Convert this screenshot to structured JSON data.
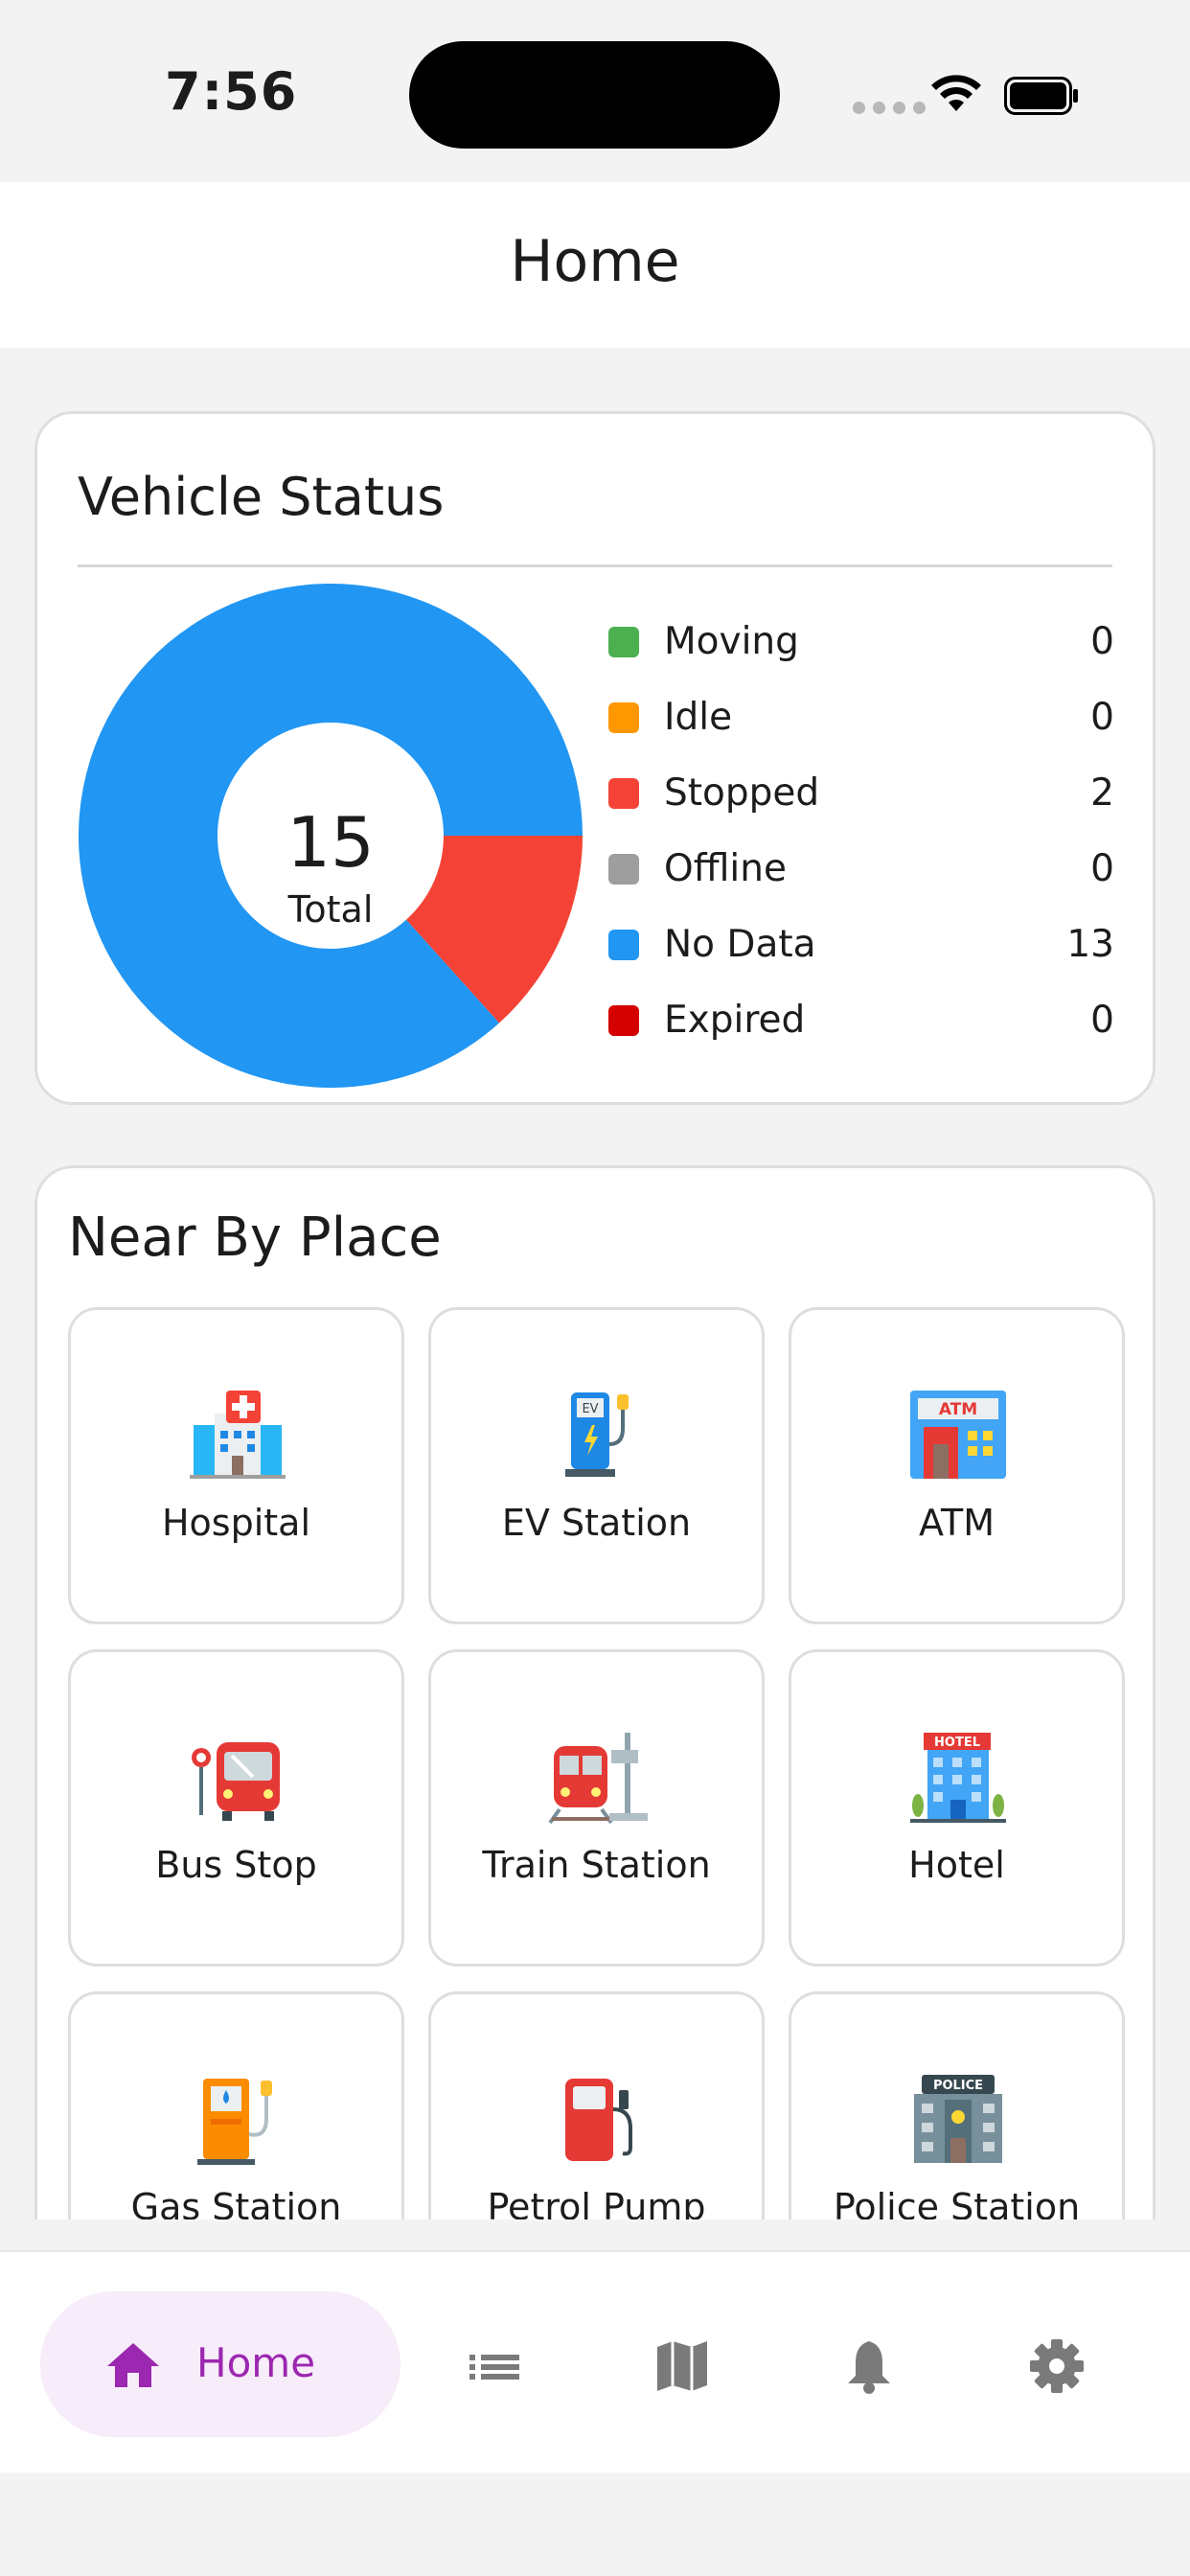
{
  "status_bar": {
    "time": "7:56"
  },
  "header": {
    "title": "Home"
  },
  "vehicle_status": {
    "title": "Vehicle Status",
    "total": "15",
    "total_label": "Total",
    "legend": [
      {
        "label": "Moving",
        "value": "0",
        "color": "#4caf50"
      },
      {
        "label": "Idle",
        "value": "0",
        "color": "#ff9800"
      },
      {
        "label": "Stopped",
        "value": "2",
        "color": "#f44336"
      },
      {
        "label": "Offline",
        "value": "0",
        "color": "#9e9e9e"
      },
      {
        "label": "No Data",
        "value": "13",
        "color": "#2196f3"
      },
      {
        "label": "Expired",
        "value": "0",
        "color": "#d50000"
      }
    ]
  },
  "chart_data": {
    "type": "pie",
    "categories": [
      "Moving",
      "Idle",
      "Stopped",
      "Offline",
      "No Data",
      "Expired"
    ],
    "values": [
      0,
      0,
      2,
      0,
      13,
      0
    ],
    "colors": [
      "#4caf50",
      "#ff9800",
      "#f44336",
      "#9e9e9e",
      "#2196f3",
      "#d50000"
    ],
    "title": "Vehicle Status",
    "legend": "right"
  },
  "nearby": {
    "title": "Near By Place",
    "items": [
      {
        "label": "Hospital",
        "icon": "hospital-icon"
      },
      {
        "label": "EV Station",
        "icon": "ev-station-icon"
      },
      {
        "label": "ATM",
        "icon": "atm-icon"
      },
      {
        "label": "Bus Stop",
        "icon": "bus-stop-icon"
      },
      {
        "label": "Train Station",
        "icon": "train-station-icon"
      },
      {
        "label": "Hotel",
        "icon": "hotel-icon"
      },
      {
        "label": "Gas Station",
        "icon": "gas-station-icon"
      },
      {
        "label": "Petrol Pump",
        "icon": "petrol-pump-icon"
      },
      {
        "label": "Police Station",
        "icon": "police-station-icon"
      }
    ]
  },
  "bottom_nav": {
    "active_label": "Home",
    "active_color": "#9c27b0",
    "items": [
      "home-icon",
      "list-icon",
      "map-icon",
      "bell-icon",
      "gear-icon"
    ]
  }
}
